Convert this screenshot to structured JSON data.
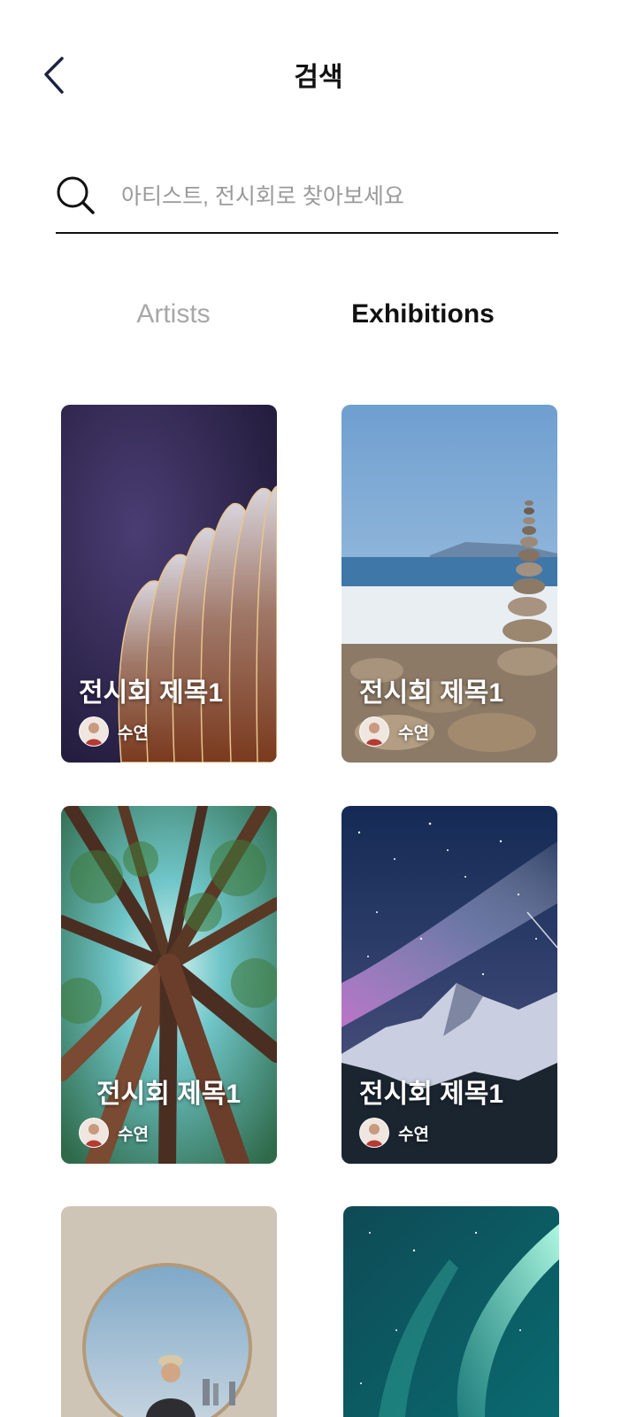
{
  "header": {
    "title": "검색",
    "back_icon": "chevron-left-icon"
  },
  "search": {
    "placeholder": "아티스트, 전시회로 찾아보세요",
    "value": "",
    "icon": "search-icon"
  },
  "tabs": [
    {
      "label": "Artists",
      "active": false
    },
    {
      "label": "Exhibitions",
      "active": true
    }
  ],
  "colors": {
    "text_primary": "#111111",
    "tab_inactive": "#a8a8a8",
    "placeholder": "#9a9a9a",
    "background": "#ffffff"
  },
  "exhibitions": [
    {
      "title": "전시회 제목1",
      "artist": "수연",
      "image": "abstract-sculpture-image"
    },
    {
      "title": "전시회 제목1",
      "artist": "수연",
      "image": "stacked-stones-beach-image"
    },
    {
      "title": "전시회 제목1",
      "artist": "수연",
      "image": "redwood-forest-canopy-image"
    },
    {
      "title": "전시회 제목1",
      "artist": "수연",
      "image": "milky-way-mountain-image"
    },
    {
      "title": "",
      "artist": "",
      "image": "arch-portrait-image"
    },
    {
      "title": "",
      "artist": "",
      "image": "aurora-sky-image"
    }
  ]
}
